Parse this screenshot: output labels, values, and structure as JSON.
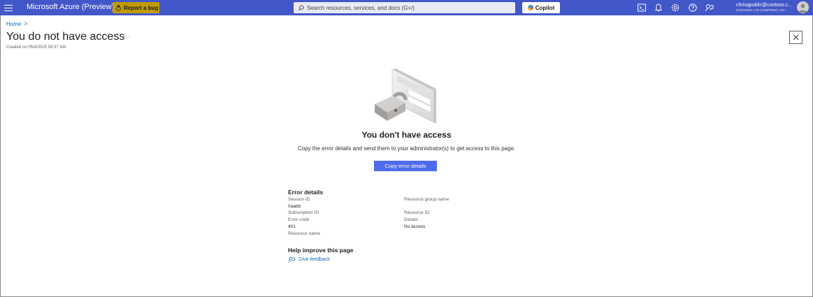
{
  "topbar": {
    "app_title": "Microsoft Azure (Preview)",
    "report_bug_label": "Report a bug",
    "search_placeholder": "Search resources, services, and docs (G+/)",
    "copilot_label": "Copilot",
    "account_name": "chrisqpublic@contoso.c...",
    "account_org": "CONTOSO, LTD (CONTOSO, LTD...",
    "icons": [
      "menu-icon",
      "bug-icon",
      "search-icon",
      "copilot-icon",
      "cloud-shell-icon",
      "notifications-icon",
      "settings-icon",
      "help-icon",
      "feedback-icon"
    ],
    "colors": {
      "bar": "#4257c8",
      "report_bug": "#c19c00"
    }
  },
  "breadcrumb": {
    "home": "Home",
    "separator": ">"
  },
  "header": {
    "title": "You do not have access",
    "more_label": "...",
    "created": "Created on 05/4/2025 09:37 AM"
  },
  "main": {
    "heading": "You don't have access",
    "description": "Copy the error details and send them to your administrator(s) to get access to this page.",
    "copy_button": "Copy error details"
  },
  "error_details": {
    "title": "Error details",
    "session_id_label": "Session ID",
    "session_id_value": "0aabb",
    "subscription_id_label": "Subscription ID",
    "error_code_label": "Error code",
    "error_code_value": "401",
    "resource_name_label": "Resource name",
    "resource_group_label": "Resource group name",
    "resource_id_label": "Resource ID",
    "details_label": "Details",
    "details_value": "No access"
  },
  "help": {
    "title": "Help improve this page",
    "feedback_link": "Give feedback"
  }
}
